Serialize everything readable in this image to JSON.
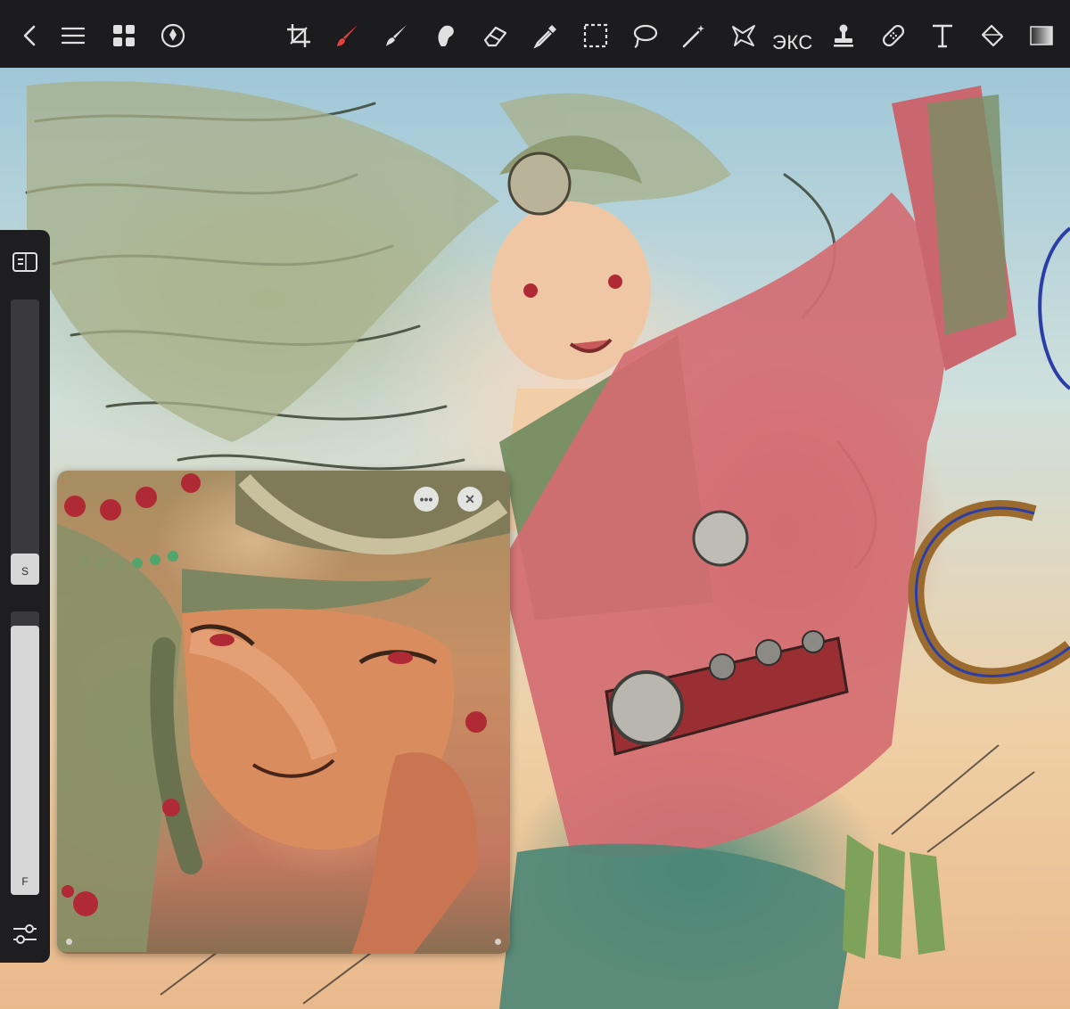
{
  "toolbar": {
    "left": [
      {
        "name": "back-icon"
      },
      {
        "name": "menu-icon"
      },
      {
        "name": "gallery-grid-icon"
      },
      {
        "name": "navigator-icon"
      }
    ],
    "tools": [
      {
        "name": "crop-icon"
      },
      {
        "name": "brush-icon",
        "active": true,
        "color": "#e8413c"
      },
      {
        "name": "smudge-icon"
      },
      {
        "name": "fill-blob-icon"
      },
      {
        "name": "eraser-icon"
      },
      {
        "name": "eyedropper-icon"
      },
      {
        "name": "rect-select-icon"
      },
      {
        "name": "lasso-icon"
      },
      {
        "name": "magic-wand-icon"
      },
      {
        "name": "warp-select-icon"
      },
      {
        "name": "stamp-icon"
      },
      {
        "name": "healing-icon"
      },
      {
        "name": "text-icon"
      },
      {
        "name": "fill-icon"
      },
      {
        "name": "gradient-icon"
      }
    ],
    "exc_label": "ЭКС"
  },
  "sidebar": {
    "size_label": "S",
    "flow_label": "F",
    "size_level": 0.11,
    "flow_level": 0.95
  },
  "reference": {
    "more_label": "•••",
    "close_label": "✕"
  },
  "colors": {
    "toolbar_bg": "#1c1c1e",
    "accent": "#e8413c"
  }
}
